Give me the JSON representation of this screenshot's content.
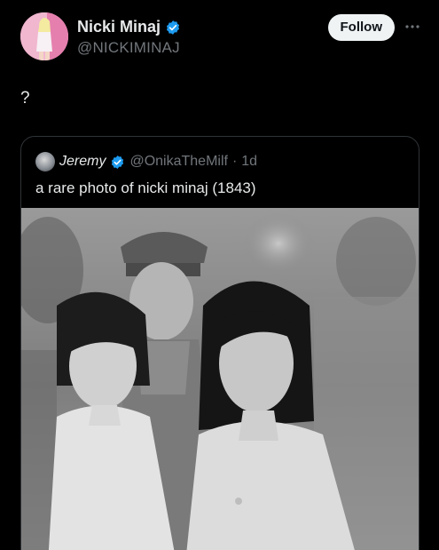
{
  "tweet": {
    "author": {
      "display_name": "Nicki Minaj",
      "handle": "@NICKIMINAJ",
      "verified": true
    },
    "follow_label": "Follow",
    "more_icon": "more-horizontal-icon",
    "text": "?"
  },
  "quoted_tweet": {
    "author": {
      "display_name": "Jeremy",
      "handle": "@OnikaTheMilf",
      "separator": "·",
      "time": "1d",
      "verified": true
    },
    "text": "a rare photo of nicki minaj (1843)",
    "media": {
      "type": "black-and-white-photo"
    }
  },
  "colors": {
    "background": "#000000",
    "text_primary": "#e7e9ea",
    "text_secondary": "#71767b",
    "verified_blue": "#1d9bf0",
    "border": "#2f3336",
    "follow_bg": "#eff3f4"
  }
}
